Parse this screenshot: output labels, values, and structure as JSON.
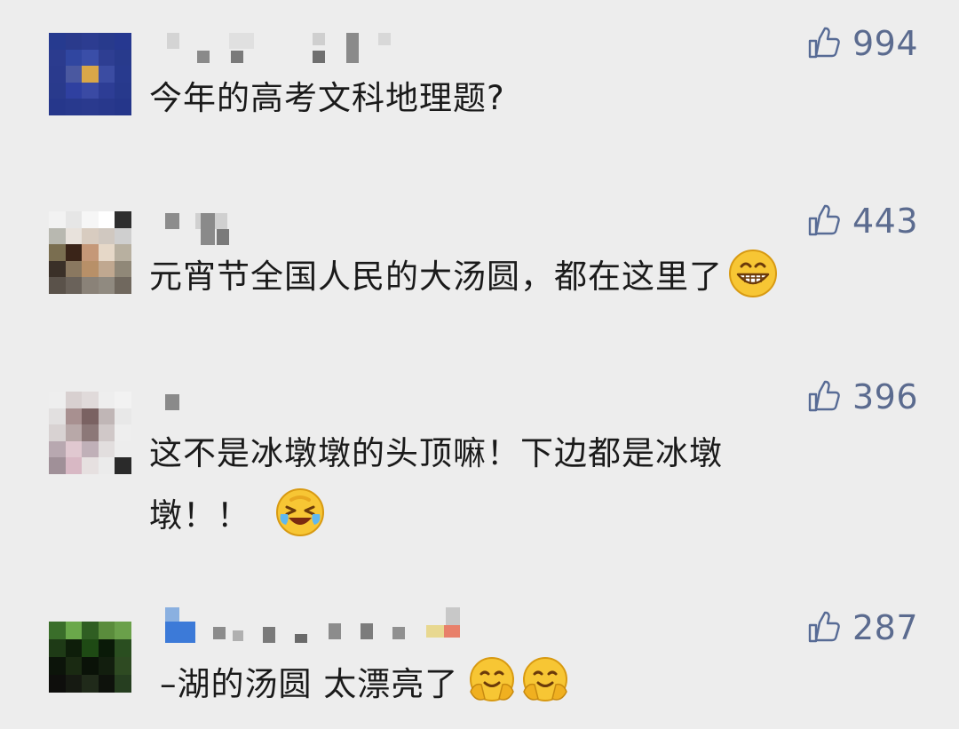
{
  "comments": [
    {
      "likes": "994",
      "text": "今年的高考文科地理题?",
      "emojis": []
    },
    {
      "likes": "443",
      "text": "元宵节全国人民的大汤圆，都在这里了",
      "emojis": [
        "grinning-face-icon"
      ]
    },
    {
      "likes": "396",
      "text_line1": "这不是冰墩墩的头顶嘛！下边都是冰墩",
      "text_line2": "墩！！",
      "emojis": [
        "laughing-crying-face-icon"
      ]
    },
    {
      "likes": "287",
      "text": "–湖的汤圆 太漂亮了",
      "emojis": [
        "hugging-face-icon",
        "hugging-face-icon"
      ]
    }
  ],
  "colors": {
    "background": "#ededed",
    "like_blue": "#576b95",
    "text": "#1a1a1a"
  },
  "icons": {
    "like": "thumbs-up-icon"
  }
}
